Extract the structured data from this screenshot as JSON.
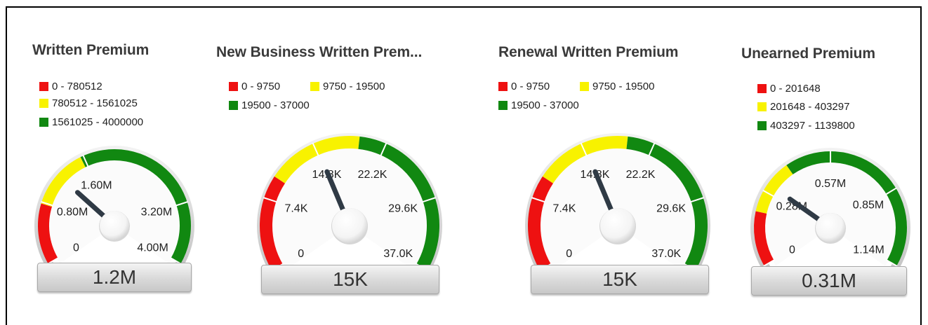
{
  "colors": {
    "red": "#ee1111",
    "yellow": "#f8f200",
    "green": "#118811",
    "needle": "#2f3a45"
  },
  "gauges": [
    {
      "title": "Written Premium",
      "legend": [
        "0 - 780512",
        "780512 - 1561025",
        "1561025 - 4000000"
      ],
      "max": 4000000,
      "bands": [
        780512,
        1561025,
        4000000
      ],
      "value": 1200000,
      "value_label": "1.2M",
      "ticks": [
        {
          "v": 0,
          "label": "0"
        },
        {
          "v": 800000,
          "label": "0.80M"
        },
        {
          "v": 1600000,
          "label": "1.60M"
        },
        {
          "v": 3200000,
          "label": "3.20M"
        },
        {
          "v": 4000000,
          "label": "4.00M"
        }
      ]
    },
    {
      "title": "New Business Written Prem...",
      "legend": [
        "0 - 9750",
        "9750 - 19500",
        "19500 - 37000"
      ],
      "max": 37000,
      "bands": [
        9750,
        19500,
        37000
      ],
      "value": 15000,
      "value_label": "15K",
      "ticks": [
        {
          "v": 0,
          "label": "0"
        },
        {
          "v": 7400,
          "label": "7.4K"
        },
        {
          "v": 14800,
          "label": "14.8K"
        },
        {
          "v": 22200,
          "label": "22.2K"
        },
        {
          "v": 29600,
          "label": "29.6K"
        },
        {
          "v": 37000,
          "label": "37.0K"
        }
      ]
    },
    {
      "title": "Renewal Written Premium",
      "legend": [
        "0 - 9750",
        "9750 - 19500",
        "19500 - 37000"
      ],
      "max": 37000,
      "bands": [
        9750,
        19500,
        37000
      ],
      "value": 15000,
      "value_label": "15K",
      "ticks": [
        {
          "v": 0,
          "label": "0"
        },
        {
          "v": 7400,
          "label": "7.4K"
        },
        {
          "v": 14800,
          "label": "14.8K"
        },
        {
          "v": 22200,
          "label": "22.2K"
        },
        {
          "v": 29600,
          "label": "29.6K"
        },
        {
          "v": 37000,
          "label": "37.0K"
        }
      ]
    },
    {
      "title": "Unearned Premium",
      "legend": [
        "0 - 201648",
        "201648 - 403297",
        "403297 - 1139800"
      ],
      "max": 1139800,
      "bands": [
        201648,
        403297,
        1139800
      ],
      "value": 310000,
      "value_label": "0.31M",
      "ticks": [
        {
          "v": 0,
          "label": "0"
        },
        {
          "v": 280000,
          "label": "0.28M"
        },
        {
          "v": 570000,
          "label": "0.57M"
        },
        {
          "v": 850000,
          "label": "0.85M"
        },
        {
          "v": 1140000,
          "label": "1.14M"
        }
      ]
    }
  ]
}
